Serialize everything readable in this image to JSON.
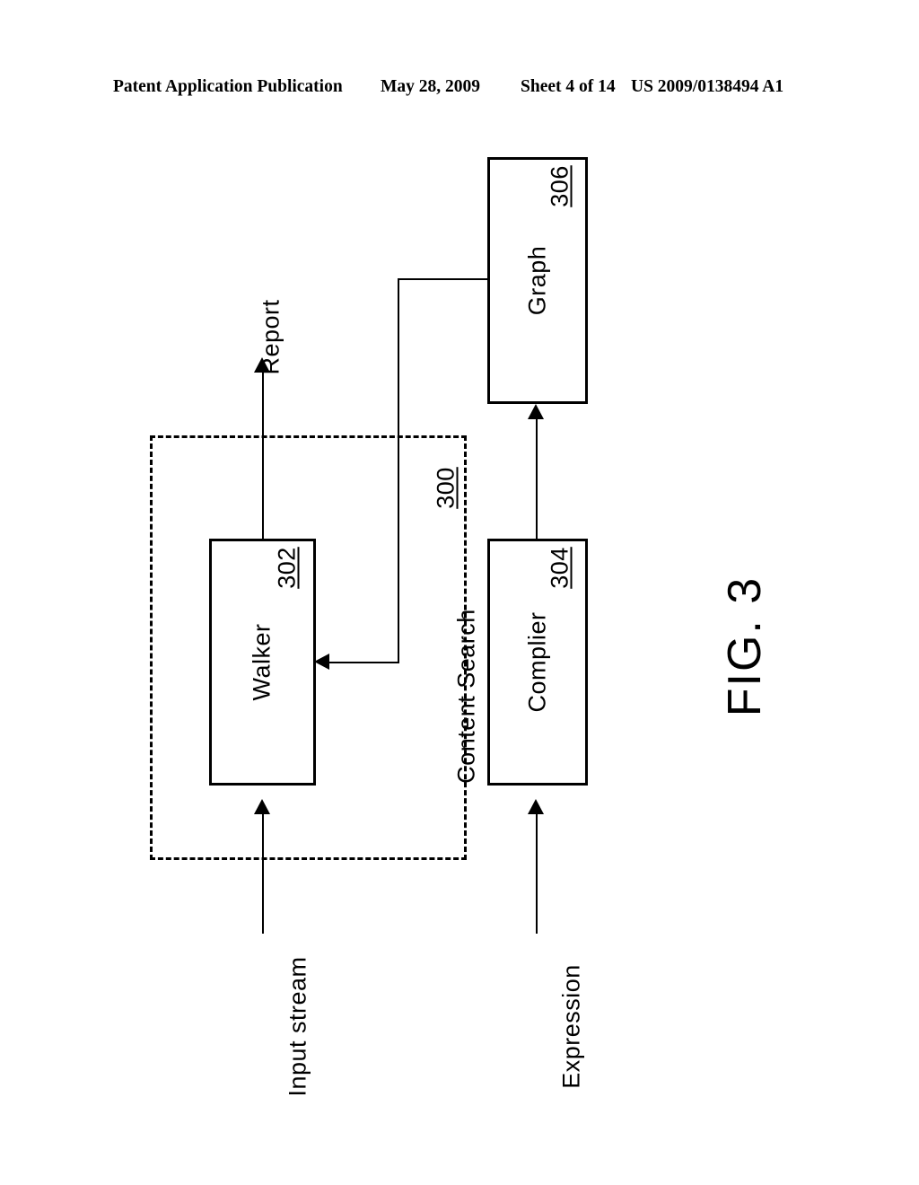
{
  "header": {
    "publication": "Patent Application Publication",
    "date": "May 28, 2009",
    "sheet": "Sheet 4 of 14",
    "patent_number": "US 2009/0138494 A1"
  },
  "figure": {
    "caption": "FIG. 3",
    "group": {
      "label": "Content Search",
      "ref": "300"
    },
    "blocks": [
      {
        "label": "Walker",
        "ref": "302"
      },
      {
        "label": "Complier",
        "ref": "304"
      },
      {
        "label": "Graph",
        "ref": "306"
      }
    ],
    "flows": [
      {
        "label": "Report"
      },
      {
        "label": "Input stream"
      },
      {
        "label": "Expression"
      }
    ]
  }
}
